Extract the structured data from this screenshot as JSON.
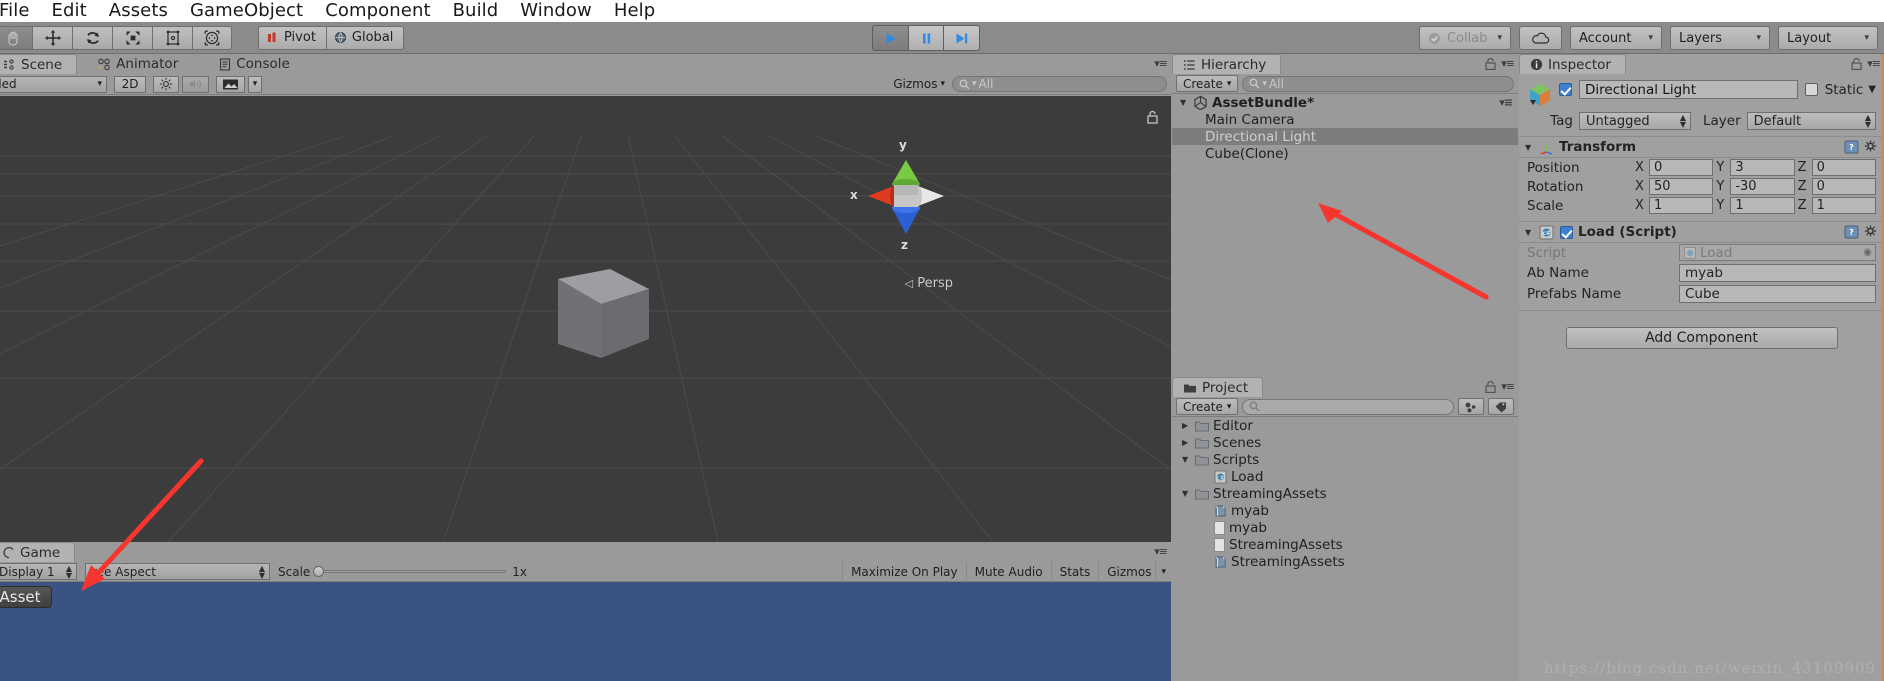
{
  "menu": {
    "items": [
      "File",
      "Edit",
      "Assets",
      "GameObject",
      "Component",
      "Build",
      "Window",
      "Help"
    ]
  },
  "toolbar": {
    "transform_tools": [
      {
        "name": "hand-tool",
        "selected": true
      },
      {
        "name": "move-tool",
        "selected": false
      },
      {
        "name": "rotate-tool",
        "selected": false
      },
      {
        "name": "scale-tool",
        "selected": false
      },
      {
        "name": "rect-tool",
        "selected": false
      },
      {
        "name": "transform-tool",
        "selected": false
      }
    ],
    "pivot_label": "Pivot",
    "global_label": "Global",
    "play_label": "▶",
    "pause_label": "II",
    "step_label": "▶|",
    "collab_label": "Collab",
    "cloud_label": "",
    "account_label": "Account",
    "layers_label": "Layers",
    "layout_label": "Layout",
    "caret": "▾"
  },
  "scene": {
    "tabs": [
      {
        "label": "Scene",
        "icon": "scene-icon",
        "active": true
      },
      {
        "label": "Animator",
        "icon": "animator-icon",
        "active": false
      },
      {
        "label": "Console",
        "icon": "console-icon",
        "active": false
      }
    ],
    "shading_mode": "haded",
    "toggle_2d": "2D",
    "lighting_icon": "sun-icon",
    "audio_icon": "speaker-icon",
    "fx_icon": "image-icon",
    "gizmos_label": "Gizmos",
    "search_placeholder": "All",
    "gizmo_axes": {
      "x": "x",
      "y": "y",
      "z": "z"
    },
    "projection_label": "Persp",
    "background_color": "#3c3c3c",
    "grid_color": "#4a4a4a"
  },
  "game": {
    "tabs": [
      {
        "label": "Game",
        "icon": "game-icon",
        "active": true
      }
    ],
    "display_label": "Display 1",
    "aspect_label": "ree Aspect",
    "scale_label": "Scale",
    "scale_value": "1x",
    "maximize_label": "Maximize On Play",
    "mute_label": "Mute Audio",
    "stats_label": "Stats",
    "gizmos_label": "Gizmos",
    "overlay_button_label": "basAsset",
    "view_color": "#3a5383"
  },
  "hierarchy": {
    "tab_label": "Hierarchy",
    "create_label": "Create",
    "search_placeholder": "All",
    "items": [
      {
        "label": "AssetBundle*",
        "depth": 0,
        "icon": "unity-scene-icon",
        "selected": false,
        "expanded": true
      },
      {
        "label": "Main Camera",
        "depth": 1,
        "icon": "",
        "selected": false
      },
      {
        "label": "Directional Light",
        "depth": 1,
        "icon": "",
        "selected": true
      },
      {
        "label": "Cube(Clone)",
        "depth": 1,
        "icon": "",
        "selected": false
      }
    ]
  },
  "project": {
    "tab_label": "Project",
    "create_label": "Create",
    "search_placeholder": "",
    "items": [
      {
        "label": "Editor",
        "depth": 0,
        "icon": "folder-icon",
        "expanded": false
      },
      {
        "label": "Scenes",
        "depth": 0,
        "icon": "folder-icon",
        "expanded": false
      },
      {
        "label": "Scripts",
        "depth": 0,
        "icon": "folder-icon",
        "expanded": true
      },
      {
        "label": "Load",
        "depth": 1,
        "icon": "csharp-icon"
      },
      {
        "label": "StreamingAssets",
        "depth": 0,
        "icon": "folder-icon",
        "expanded": true
      },
      {
        "label": "myab",
        "depth": 1,
        "icon": "assetbundle-icon"
      },
      {
        "label": "myab",
        "depth": 1,
        "icon": "document-icon"
      },
      {
        "label": "StreamingAssets",
        "depth": 1,
        "icon": "document-icon"
      },
      {
        "label": "StreamingAssets",
        "depth": 1,
        "icon": "assetbundle-icon"
      }
    ]
  },
  "inspector": {
    "tab_label": "Inspector",
    "object_name": "Directional Light",
    "object_enabled": true,
    "static_label": "Static",
    "static_checked": false,
    "tag_label": "Tag",
    "tag_value": "Untagged",
    "layer_label": "Layer",
    "layer_value": "Default",
    "transform": {
      "title": "Transform",
      "rows": [
        {
          "label": "Position",
          "x": "0",
          "y": "3",
          "z": "0"
        },
        {
          "label": "Rotation",
          "x": "50",
          "y": "-30",
          "z": "0"
        },
        {
          "label": "Scale",
          "x": "1",
          "y": "1",
          "z": "1"
        }
      ],
      "axis_labels": [
        "X",
        "Y",
        "Z"
      ]
    },
    "script_component": {
      "title": "Load (Script)",
      "enabled": true,
      "script_label": "Script",
      "script_value": "Load",
      "fields": [
        {
          "label": "Ab Name",
          "value": "myab"
        },
        {
          "label": "Prefabs Name",
          "value": "Cube"
        }
      ]
    },
    "add_component_label": "Add Component"
  },
  "watermark": "https://blog.csdn.net/weixin_43109909",
  "accent_colors": {
    "selection": "#7d7d7d",
    "annotation_arrow": "#f5352e",
    "play_blue": "#2f8ae8",
    "axis_x": "#e03b20",
    "axis_y": "#7ac943",
    "axis_z": "#2a5fd6"
  }
}
